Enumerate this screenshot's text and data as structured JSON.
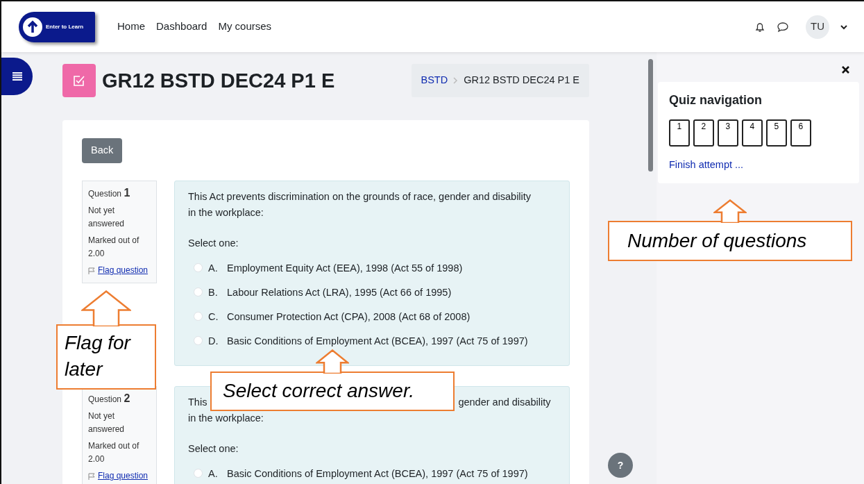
{
  "navbar": {
    "logo_text": "Enter to Learn",
    "links": [
      "Home",
      "Dashboard",
      "My courses"
    ],
    "avatar": "TU"
  },
  "page": {
    "title": "GR12 BSTD DEC24 P1 E",
    "breadcrumb": [
      {
        "label": "BSTD",
        "link": true
      },
      {
        "label": "GR12 BSTD DEC24 P1 E",
        "link": false
      }
    ],
    "back_button": "Back"
  },
  "questions": [
    {
      "label": "Question",
      "number": "1",
      "status": "Not yet answered",
      "marks_label": "Marked out of",
      "marks": "2.00",
      "flag": "Flag question",
      "prompt_lines": [
        [
          "This Act prevents discrimination on the grounds of race, gender and disability"
        ],
        [
          "in the workplace:"
        ]
      ],
      "instruction": "Select one:",
      "options": [
        {
          "letter": "A.",
          "text": "Employment Equity Act (EEA), 1998 (Act 55 of 1998)",
          "selected": false
        },
        {
          "letter": "B.",
          "text": "Labour Relations Act (LRA), 1995 (Act 66 of 1995)",
          "selected": false
        },
        {
          "letter": "C.",
          "text": "Consumer Protection Act (CPA), 2008 (Act 68 of 2008)",
          "selected": false
        },
        {
          "letter": "D.",
          "text": "Basic Conditions of Employment Act (BCEA), 1997 (Act 75 of 1997)",
          "selected": false
        }
      ]
    },
    {
      "label": "Question",
      "number": "2",
      "status": "Not yet answered",
      "marks_label": "Marked out of",
      "marks": "2.00",
      "flag": "Flag question",
      "prompt_lines": [
        [
          "This",
          "gender and disability"
        ],
        [
          "in the workplace:"
        ]
      ],
      "instruction": "Select one:",
      "options": [
        {
          "letter": "A.",
          "text": "Basic Conditions of Employment Act (BCEA), 1997 (Act 75 of 1997)",
          "selected": false
        }
      ]
    }
  ],
  "quiz_navigation": {
    "title": "Quiz navigation",
    "buttons": [
      "1",
      "2",
      "3",
      "4",
      "5",
      "6"
    ],
    "finish": "Finish attempt ..."
  },
  "help_button": "?",
  "callouts": [
    {
      "kind": "flag",
      "text": "Flag for later"
    },
    {
      "kind": "answer",
      "text": "Select correct answer."
    },
    {
      "kind": "count",
      "text": "Number of questions"
    }
  ]
}
